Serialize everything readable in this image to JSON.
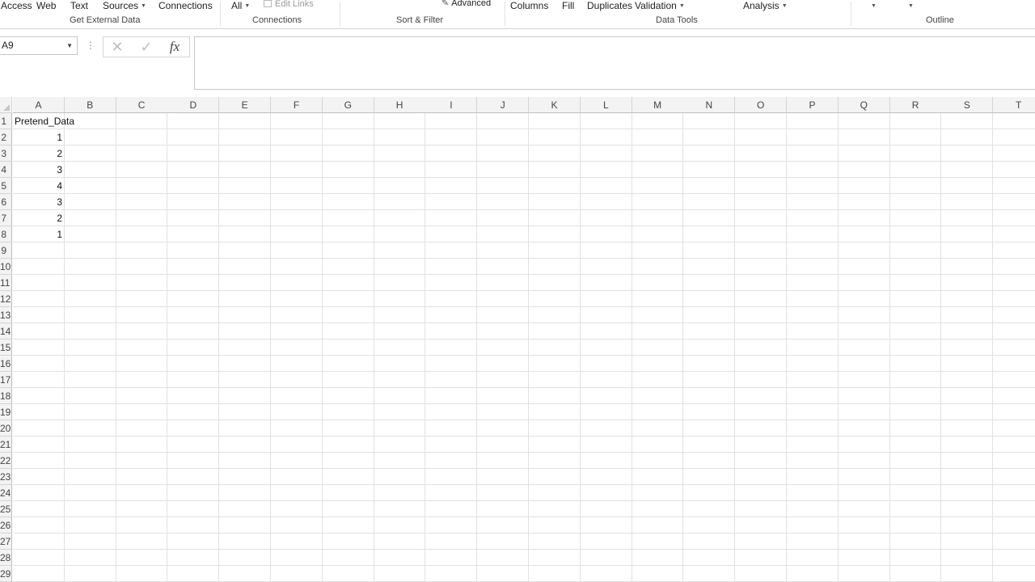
{
  "ribbon": {
    "items": {
      "access": "Access",
      "web": "Web",
      "text": "Text",
      "sources": "Sources",
      "connections": "Connections",
      "all": "All",
      "edit_links": "Edit Links",
      "advanced": "Advanced",
      "columns": "Columns",
      "fill": "Fill",
      "duplicates": "Duplicates",
      "validation": "Validation",
      "analysis": "Analysis"
    },
    "groups": {
      "get_external_data": "Get External Data",
      "connections": "Connections",
      "sort_filter": "Sort & Filter",
      "data_tools": "Data Tools",
      "outline": "Outline"
    }
  },
  "formula_bar": {
    "name_box": "A9",
    "dots": "⋮",
    "cancel_glyph": "✕",
    "enter_glyph": "✓",
    "fx_label": "fx",
    "formula": ""
  },
  "sheet": {
    "columns": [
      "A",
      "B",
      "C",
      "D",
      "E",
      "F",
      "G",
      "H",
      "I",
      "J",
      "K",
      "L",
      "M",
      "N",
      "O",
      "P",
      "Q",
      "R",
      "S",
      "T"
    ],
    "rows": [
      "1",
      "2",
      "3",
      "4",
      "5",
      "6",
      "7",
      "8",
      "9",
      "10",
      "11",
      "12",
      "13",
      "14",
      "15",
      "16",
      "17",
      "18",
      "19",
      "20",
      "21",
      "22",
      "23",
      "24",
      "25",
      "26",
      "27",
      "28",
      "29"
    ],
    "cells": {
      "a1": "Pretend_Data",
      "a2": "1",
      "a3": "2",
      "a4": "3",
      "a5": "4",
      "a6": "3",
      "a7": "2",
      "a8": "1"
    }
  },
  "colors": {
    "header_bg": "#f3f3f3",
    "gridline": "#e1e1e1",
    "header_border": "#bdbdbd"
  }
}
